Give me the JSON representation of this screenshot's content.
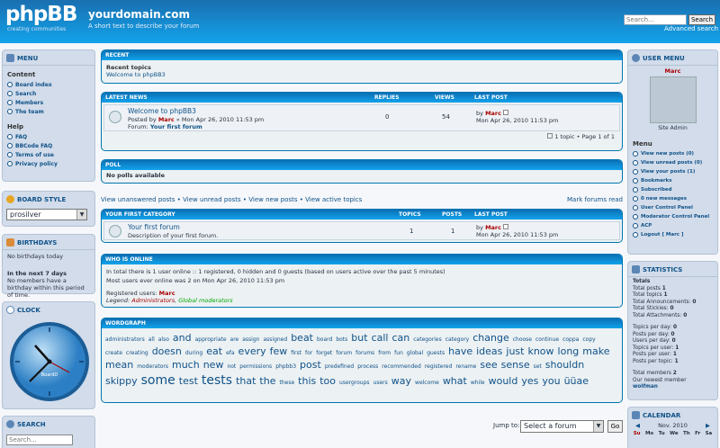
{
  "header": {
    "logo_text": "phpBB",
    "logo_sub": "creating communities",
    "site_name": "yourdomain.com",
    "site_desc": "A short text to describe your forum",
    "search_placeholder": "Search…",
    "search_button": "Search",
    "advanced_search": "Advanced search"
  },
  "left_menu": {
    "title": "Menu",
    "content_label": "Content",
    "content_items": [
      "Board index",
      "Search",
      "Members",
      "The team"
    ],
    "help_label": "Help",
    "help_items": [
      "FAQ",
      "BBCode FAQ",
      "Terms of use",
      "Privacy policy"
    ]
  },
  "board_style": {
    "title": "Board style",
    "selected": "prosilver"
  },
  "birthdays": {
    "title": "Birthdays",
    "today": "No birthdays today",
    "next7_label": "In the next 7 days",
    "next7_text": "No members have a birthday within this period of time."
  },
  "clock": {
    "title": "Clock",
    "brand": "BoardD"
  },
  "search_side": {
    "title": "Search",
    "placeholder": "Search..."
  },
  "recent": {
    "title": "Recent",
    "sub": "Recent topics",
    "item": "Welcome to phpBB3"
  },
  "latest_news": {
    "title": "Latest news",
    "col_replies": "Replies",
    "col_views": "Views",
    "col_last": "Last post",
    "topic": "Welcome to phpBB3",
    "posted_by": "Posted by",
    "author": "Marc",
    "posted_date": "» Mon Apr 26, 2010 11:53 pm",
    "forum_label": "Forum:",
    "forum_name": "Your first forum",
    "replies": "0",
    "views": "54",
    "last_by": "by",
    "last_author": "Marc",
    "last_date": "Mon Apr 26, 2010 11:53 pm",
    "pager": "1 topic • Page 1 of 1"
  },
  "poll": {
    "title": "Poll",
    "text": "No polls available"
  },
  "quick_links": {
    "links": [
      "View unanswered posts",
      "View unread posts",
      "View new posts",
      "View active topics"
    ],
    "mark_read": "Mark forums read"
  },
  "category": {
    "title": "Your first category",
    "col_topics": "Topics",
    "col_posts": "Posts",
    "col_last": "Last post",
    "forum_name": "Your first forum",
    "forum_desc": "Description of your first forum.",
    "topics": "1",
    "posts": "1",
    "last_by": "by",
    "last_author": "Marc",
    "last_date": "Mon Apr 26, 2010 11:53 pm"
  },
  "online": {
    "title": "Who is online",
    "line1": "In total there is 1 user online :: 1 registered, 0 hidden and 0 guests (based on users active over the past 5 minutes)",
    "line2": "Most users ever online was 2 on Mon Apr 26, 2010 11:53 pm",
    "registered_label": "Registered users:",
    "registered_user": "Marc",
    "legend_label": "Legend:",
    "legend_admins": "Administrators",
    "legend_mods": "Global moderators"
  },
  "wordgraph": {
    "title": "Wordgraph",
    "words": [
      {
        "w": "administrators",
        "s": 6
      },
      {
        "w": "all",
        "s": 6
      },
      {
        "w": "also",
        "s": 6
      },
      {
        "w": "and",
        "s": 11
      },
      {
        "w": "appropriate",
        "s": 6
      },
      {
        "w": "are",
        "s": 6
      },
      {
        "w": "assign",
        "s": 6
      },
      {
        "w": "assigned",
        "s": 6
      },
      {
        "w": "beat",
        "s": 11
      },
      {
        "w": "board",
        "s": 6
      },
      {
        "w": "bots",
        "s": 6
      },
      {
        "w": "but",
        "s": 11
      },
      {
        "w": "call",
        "s": 11
      },
      {
        "w": "can",
        "s": 11
      },
      {
        "w": "categories",
        "s": 6
      },
      {
        "w": "category",
        "s": 6
      },
      {
        "w": "change",
        "s": 11
      },
      {
        "w": "choose",
        "s": 6
      },
      {
        "w": "continue",
        "s": 6
      },
      {
        "w": "coppa",
        "s": 6
      },
      {
        "w": "copy",
        "s": 6
      },
      {
        "w": "create",
        "s": 6
      },
      {
        "w": "creating",
        "s": 6
      },
      {
        "w": "doesn",
        "s": 11
      },
      {
        "w": "during",
        "s": 6
      },
      {
        "w": "eat",
        "s": 11
      },
      {
        "w": "efa",
        "s": 6
      },
      {
        "w": "every",
        "s": 11
      },
      {
        "w": "few",
        "s": 11
      },
      {
        "w": "first",
        "s": 6
      },
      {
        "w": "for",
        "s": 6
      },
      {
        "w": "forget",
        "s": 6
      },
      {
        "w": "forum",
        "s": 6
      },
      {
        "w": "forums",
        "s": 6
      },
      {
        "w": "from",
        "s": 6
      },
      {
        "w": "fun",
        "s": 6
      },
      {
        "w": "global",
        "s": 6
      },
      {
        "w": "guests",
        "s": 6
      },
      {
        "w": "have",
        "s": 11
      },
      {
        "w": "ideas",
        "s": 11
      },
      {
        "w": "just",
        "s": 11
      },
      {
        "w": "know",
        "s": 11
      },
      {
        "w": "long",
        "s": 11
      },
      {
        "w": "make",
        "s": 11
      },
      {
        "w": "mean",
        "s": 11
      },
      {
        "w": "moderators",
        "s": 6
      },
      {
        "w": "much",
        "s": 11
      },
      {
        "w": "new",
        "s": 11
      },
      {
        "w": "not",
        "s": 6
      },
      {
        "w": "permissions",
        "s": 6
      },
      {
        "w": "phpbb3",
        "s": 6
      },
      {
        "w": "post",
        "s": 11
      },
      {
        "w": "predefined",
        "s": 6
      },
      {
        "w": "process",
        "s": 6
      },
      {
        "w": "recommended",
        "s": 6
      },
      {
        "w": "registered",
        "s": 6
      },
      {
        "w": "rename",
        "s": 6
      },
      {
        "w": "see",
        "s": 11
      },
      {
        "w": "sense",
        "s": 11
      },
      {
        "w": "set",
        "s": 6
      },
      {
        "w": "shouldn",
        "s": 11
      },
      {
        "w": "skippy",
        "s": 11
      },
      {
        "w": "some",
        "s": 14
      },
      {
        "w": "test",
        "s": 11
      },
      {
        "w": "tests",
        "s": 14
      },
      {
        "w": "that",
        "s": 11
      },
      {
        "w": "the",
        "s": 11
      },
      {
        "w": "these",
        "s": 6
      },
      {
        "w": "this",
        "s": 11
      },
      {
        "w": "too",
        "s": 11
      },
      {
        "w": "usergroups",
        "s": 6
      },
      {
        "w": "users",
        "s": 6
      },
      {
        "w": "way",
        "s": 11
      },
      {
        "w": "welcome",
        "s": 6
      },
      {
        "w": "what",
        "s": 11
      },
      {
        "w": "while",
        "s": 6
      },
      {
        "w": "would",
        "s": 11
      },
      {
        "w": "yes",
        "s": 11
      },
      {
        "w": "you",
        "s": 11
      },
      {
        "w": "üüae",
        "s": 11
      }
    ]
  },
  "jump": {
    "label": "Jump to:",
    "selected": "Select a forum",
    "go": "Go"
  },
  "user_menu": {
    "title": "User menu",
    "username": "Marc",
    "role": "Site Admin",
    "menu_label": "Menu",
    "items": [
      "View new posts (0)",
      "View unread posts (0)",
      "View your posts (1)",
      "Bookmarks",
      "Subscribed",
      "0 new messages",
      "User Control Panel",
      "Moderator Control Panel",
      "ACP",
      "Logout [ Marc ]"
    ]
  },
  "statistics": {
    "title": "Statistics",
    "totals_label": "Totals",
    "totals": [
      {
        "k": "Total posts",
        "v": "1"
      },
      {
        "k": "Total topics",
        "v": "1"
      },
      {
        "k": "Total Announcements:",
        "v": "0"
      },
      {
        "k": "Total Stickies:",
        "v": "0"
      },
      {
        "k": "Total Attachments:",
        "v": "0"
      }
    ],
    "rates": [
      {
        "k": "Topics per day:",
        "v": "0"
      },
      {
        "k": "Posts per day:",
        "v": "0"
      },
      {
        "k": "Users per day:",
        "v": "0"
      },
      {
        "k": "Topics per user:",
        "v": "1"
      },
      {
        "k": "Posts per user:",
        "v": "1"
      },
      {
        "k": "Posts per topic:",
        "v": "1"
      }
    ],
    "members_label": "Total members",
    "members": "2",
    "newest_label": "Our newest member",
    "newest": "wolfman"
  },
  "calendar": {
    "title": "Calendar",
    "month": "Nov. 2010",
    "days": [
      "Su",
      "Mo",
      "Tu",
      "We",
      "Th",
      "Fr",
      "Sa"
    ]
  },
  "colors": {
    "header_dark": "#1a6fb0",
    "header_light": "#12a3eb",
    "username": "#aa0000",
    "link": "#105289"
  }
}
